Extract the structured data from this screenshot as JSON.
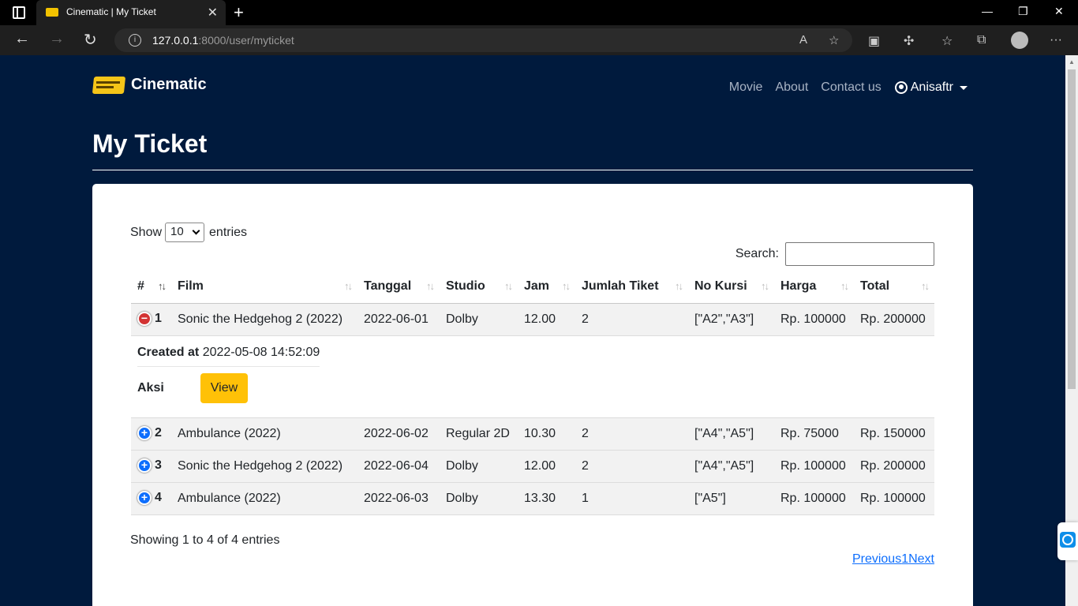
{
  "browser": {
    "tab_title": "Cinematic | My Ticket",
    "url_host": "127.0.0.1",
    "url_rest": ":8000/user/myticket"
  },
  "navbar": {
    "brand": "Cinematic",
    "links": [
      "Movie",
      "About",
      "Contact us"
    ],
    "user": "Anisaftr"
  },
  "page": {
    "title": "My Ticket"
  },
  "table_controls": {
    "show_label": "Show",
    "length_value": "10",
    "entries_label": "entries",
    "search_label": "Search:",
    "info": "Showing 1 to 4 of 4 entries",
    "prev": "Previous",
    "page": "1",
    "next": "Next"
  },
  "columns": [
    "#",
    "Film",
    "Tanggal",
    "Studio",
    "Jam",
    "Jumlah Tiket",
    "No Kursi",
    "Harga",
    "Total"
  ],
  "rows": [
    {
      "no": "1",
      "film": "Sonic the Hedgehog 2 (2022)",
      "tanggal": "2022-06-01",
      "studio": "Dolby",
      "jam": "12.00",
      "jumlah": "2",
      "kursi": "[\"A2\",\"A3\"]",
      "harga": "Rp. 100000",
      "total": "Rp. 200000"
    },
    {
      "no": "2",
      "film": "Ambulance (2022)",
      "tanggal": "2022-06-02",
      "studio": "Regular 2D",
      "jam": "10.30",
      "jumlah": "2",
      "kursi": "[\"A4\",\"A5\"]",
      "harga": "Rp. 75000",
      "total": "Rp. 150000"
    },
    {
      "no": "3",
      "film": "Sonic the Hedgehog 2 (2022)",
      "tanggal": "2022-06-04",
      "studio": "Dolby",
      "jam": "12.00",
      "jumlah": "2",
      "kursi": "[\"A4\",\"A5\"]",
      "harga": "Rp. 100000",
      "total": "Rp. 200000"
    },
    {
      "no": "4",
      "film": "Ambulance (2022)",
      "tanggal": "2022-06-03",
      "studio": "Dolby",
      "jam": "13.30",
      "jumlah": "1",
      "kursi": "[\"A5\"]",
      "harga": "Rp. 100000",
      "total": "Rp. 100000"
    }
  ],
  "child_row": {
    "created_label": "Created at",
    "created_value": "2022-05-08 14:52:09",
    "aksi_label": "Aksi",
    "view_label": "View"
  }
}
